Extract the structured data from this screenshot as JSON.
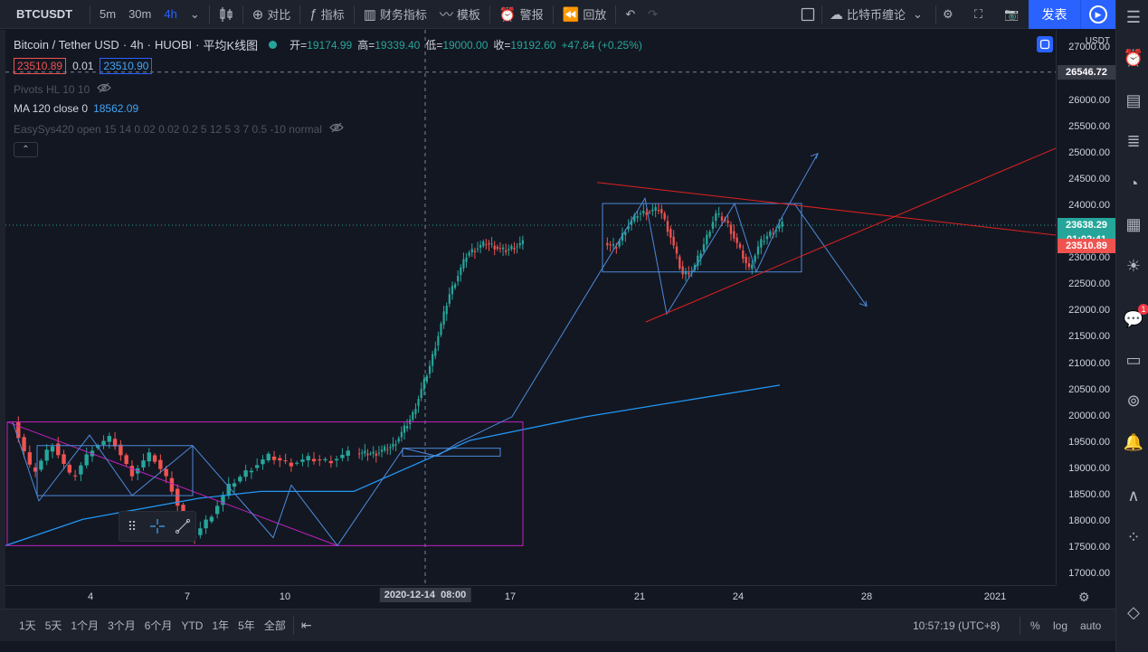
{
  "toolbar": {
    "symbol": "BTCUSDT",
    "intervals": [
      "5m",
      "30m",
      "4h"
    ],
    "active_interval": "4h",
    "compare_label": "对比",
    "indicators_label": "指标",
    "financials_label": "财务指标",
    "templates_label": "模板",
    "alert_label": "警报",
    "replay_label": "回放",
    "layout_name": "比特币缠论",
    "publish_label": "发表"
  },
  "legend": {
    "pair": "Bitcoin / Tether USD",
    "interval": "4h",
    "exchange": "HUOBI",
    "chart_style": "平均K线图",
    "open_label": "开=",
    "open": "19174.99",
    "high_label": "高=",
    "high": "19339.40",
    "low_label": "低=",
    "low": "19000.00",
    "close_label": "收=",
    "close": "19192.60",
    "change": "+47.84 (+0.25%)",
    "bid": "23510.89",
    "spread": "0.01",
    "ask": "23510.90"
  },
  "indicators": [
    {
      "name": "Pivots HL 10 10",
      "value": ""
    },
    {
      "name": "MA 120 close 0",
      "value": "18562.09"
    },
    {
      "name": "EasySys420 open 15 14 0.02 0.02 0.2 5 12 5 3 7 0.5 -10 normal",
      "value": ""
    }
  ],
  "price_axis": {
    "currency": "USDT",
    "ticks": [
      "27000.00",
      "26500.00",
      "26000.00",
      "25500.00",
      "25000.00",
      "24500.00",
      "24000.00",
      "23500.00",
      "23000.00",
      "22500.00",
      "22000.00",
      "21500.00",
      "21000.00",
      "20500.00",
      "20000.00",
      "19500.00",
      "19000.00",
      "18500.00",
      "18000.00",
      "17500.00",
      "17000.00"
    ],
    "crosshair_price": "26546.72",
    "last_price": "23638.29",
    "countdown": "01:02:41",
    "bid_price": "23510.89",
    "colors": {
      "last": "#26a69a",
      "bid": "#ef5350",
      "crosshair": "#363a45"
    }
  },
  "time_axis": {
    "ticks": [
      "4",
      "7",
      "10",
      "17",
      "21",
      "24",
      "28",
      "2021"
    ],
    "crosshair_label": "2020-12-14  08:00"
  },
  "bottom_bar": {
    "ranges": [
      "1天",
      "5天",
      "1个月",
      "3个月",
      "6个月",
      "YTD",
      "1年",
      "5年",
      "全部"
    ],
    "clock": "10:57:19 (UTC+8)",
    "percent": "%",
    "log": "log",
    "auto": "auto"
  },
  "chart_data": {
    "type": "candlestick",
    "symbol": "BTCUSDT",
    "interval": "4h",
    "y_range": [
      16800,
      27350
    ],
    "date_ticks": [
      "4",
      "7",
      "10",
      "17",
      "21",
      "24",
      "28",
      "2021"
    ],
    "segments": [
      [
        19900,
        18900,
        19500,
        18800,
        19400,
        19600,
        18900,
        19300,
        18700,
        17650,
        18100,
        18700,
        19000,
        19250,
        19100,
        19200,
        19150,
        19300
      ],
      [
        19300,
        19300,
        19450,
        20000,
        21000,
        22300,
        23100,
        23300,
        23150,
        23300
      ],
      [
        23300,
        23200,
        23600,
        23850,
        23900,
        23950,
        23400,
        22700,
        22800,
        23300,
        23850,
        23700,
        23250,
        22800,
        23300,
        23500,
        23650
      ]
    ],
    "ma120": [
      [
        0,
        17550
      ],
      [
        0.1,
        18050
      ],
      [
        0.25,
        18450
      ],
      [
        0.33,
        18580
      ],
      [
        0.45,
        18580
      ],
      [
        0.6,
        19550
      ],
      [
        0.75,
        20000
      ],
      [
        1.0,
        20600
      ]
    ],
    "colors": {
      "up": "#26a69a",
      "down": "#ef5350",
      "ma": "#2196f3",
      "box_purple": "#c020c0",
      "zigzag": "#4c8ad8",
      "trend_red": "#e02020"
    }
  }
}
